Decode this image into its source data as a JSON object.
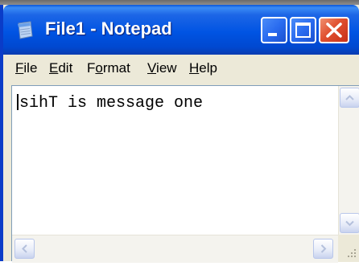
{
  "window": {
    "title": "File1 - Notepad",
    "icon": "notepad-icon"
  },
  "controls": {
    "minimize_icon": "minimize-icon",
    "maximize_icon": "maximize-icon",
    "close_icon": "close-icon"
  },
  "menu": {
    "items": [
      {
        "label": "File",
        "accel": "F",
        "rest": "ile"
      },
      {
        "label": "Edit",
        "accel": "E",
        "rest": "dit"
      },
      {
        "label": "Format",
        "pre": "F",
        "accel": "o",
        "rest": "rmat"
      },
      {
        "label": "View",
        "accel": "V",
        "rest": "iew"
      },
      {
        "label": "Help",
        "accel": "H",
        "rest": "elp"
      }
    ]
  },
  "editor": {
    "text": "sihT is message one"
  },
  "colors": {
    "titlebar": "#0054e3",
    "close_button": "#e05030",
    "window_bg": "#ece9d8"
  }
}
